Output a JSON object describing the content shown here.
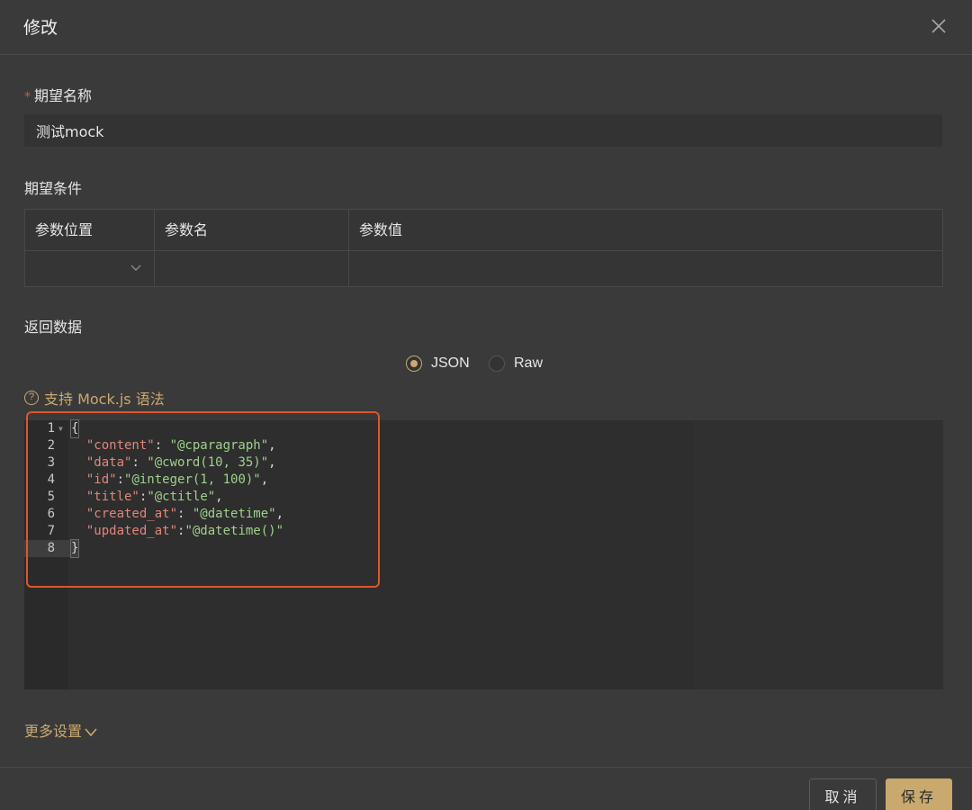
{
  "dialog": {
    "title": "修改",
    "close_icon": "close-icon"
  },
  "form": {
    "name_label": "期望名称",
    "name_required_mark": "*",
    "name_value": "测试mock",
    "conditions_label": "期望条件",
    "conditions_table": {
      "headers": [
        "参数位置",
        "参数名",
        "参数值"
      ],
      "row": {
        "position": "",
        "name": "",
        "value": ""
      }
    },
    "response_label": "返回数据",
    "format_options": [
      {
        "label": "JSON",
        "checked": true
      },
      {
        "label": "Raw",
        "checked": false
      }
    ],
    "mock_hint": "支持 Mock.js 语法",
    "more_settings": "更多设置"
  },
  "editor": {
    "lines": [
      {
        "num": "1",
        "text": "{"
      },
      {
        "num": "2",
        "text": "  \"content\": \"@cparagraph\","
      },
      {
        "num": "3",
        "text": "  \"data\": \"@cword(10, 35)\","
      },
      {
        "num": "4",
        "text": "  \"id\":\"@integer(1, 100)\","
      },
      {
        "num": "5",
        "text": "  \"title\":\"@ctitle\","
      },
      {
        "num": "6",
        "text": "  \"created_at\": \"@datetime\","
      },
      {
        "num": "7",
        "text": "  \"updated_at\":\"@datetime()\""
      },
      {
        "num": "8",
        "text": "}"
      }
    ]
  },
  "footer": {
    "cancel_label": "取消",
    "save_label": "保存"
  },
  "colors": {
    "accent": "#c9a96e",
    "background": "#3a3a3a",
    "highlight_border": "#e0552b",
    "json_key": "#e0867a",
    "json_string": "#9fd18a"
  }
}
